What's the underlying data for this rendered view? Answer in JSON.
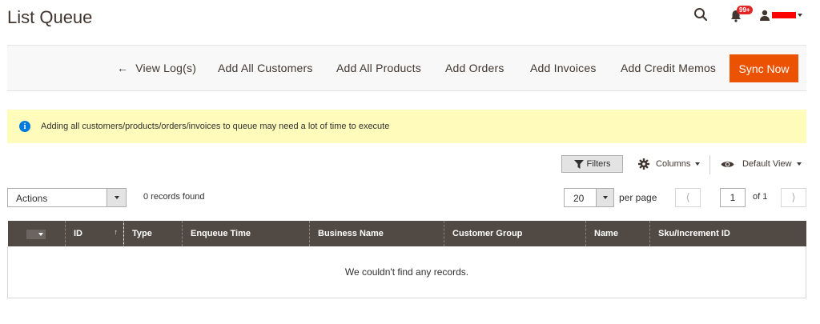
{
  "page": {
    "title": "List Queue"
  },
  "header": {
    "notifications_count": "99+",
    "icons": {
      "search": "search-icon",
      "bell": "bell-icon",
      "user": "user-icon"
    },
    "colors": {
      "badge": "#e22626",
      "username_redaction": "#ff0000"
    }
  },
  "toolbar": {
    "view_logs": "View Log(s)",
    "add_all_customers": "Add All Customers",
    "add_all_products": "Add All Products",
    "add_orders": "Add Orders",
    "add_invoices": "Add Invoices",
    "add_credit_memos": "Add Credit Memos",
    "sync_now": "Sync Now"
  },
  "notice": {
    "text": "Adding all customers/products/orders/invoices to queue may need a lot of time to execute",
    "icon": "info-icon"
  },
  "grid_controls": {
    "filters": "Filters",
    "columns": "Columns",
    "default_view": "Default View",
    "actions": "Actions",
    "records_found": "0 records found",
    "per_page_value": "20",
    "per_page_label": "per page",
    "current_page": "1",
    "of_pages": "of 1"
  },
  "grid": {
    "columns": [
      "ID",
      "Type",
      "Enqueue Time",
      "Business Name",
      "Customer Group",
      "Name",
      "Sku/Increment ID"
    ],
    "sorted_column": "ID",
    "sort_direction": "ascending",
    "empty_message": "We couldn't find any records."
  },
  "colors": {
    "accent": "#eb5202",
    "notice_bg": "#fffbbb",
    "grid_header_bg": "#514943",
    "info_icon": "#007bdb"
  }
}
